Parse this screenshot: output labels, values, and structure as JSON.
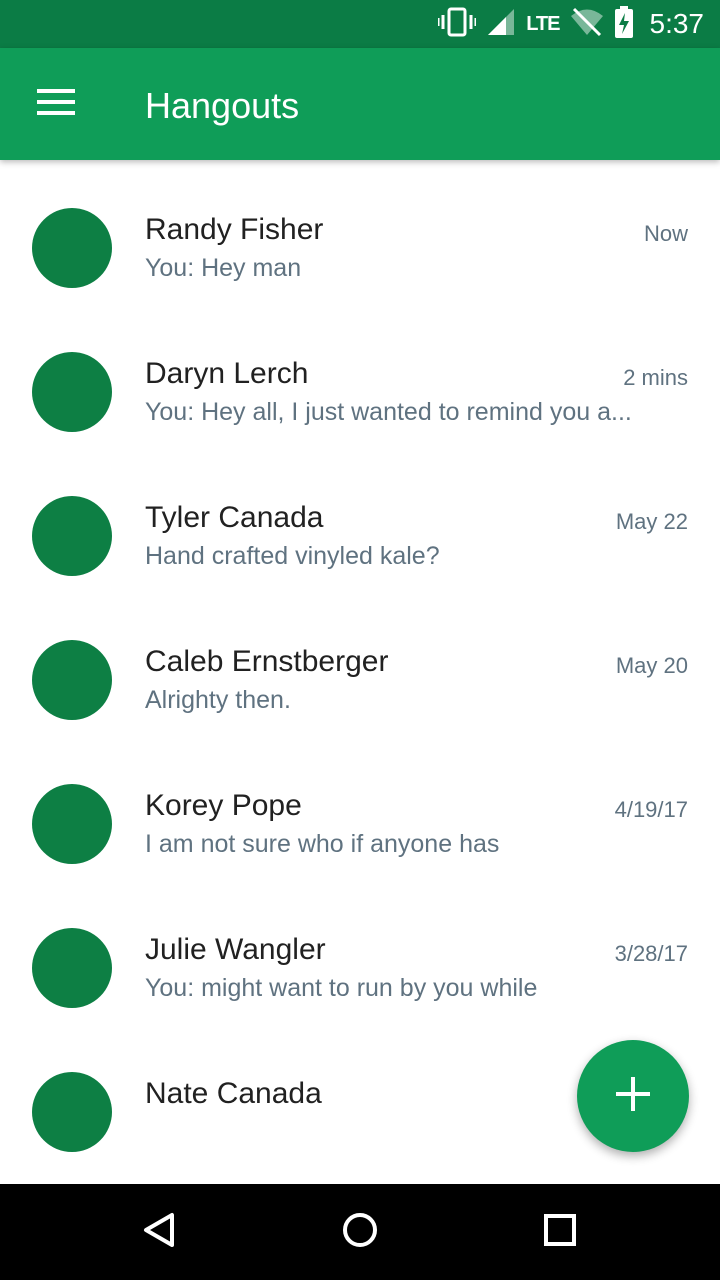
{
  "status_bar": {
    "time": "5:37",
    "network_label": "LTE",
    "icons": [
      "vibrate-icon",
      "cell-signal-icon",
      "wifi-off-icon",
      "battery-charging-icon"
    ],
    "background_color": "#0b7c45"
  },
  "app_bar": {
    "title": "Hangouts",
    "menu_icon": "hamburger-menu-icon",
    "background_color": "#0f9d58"
  },
  "conversations": [
    {
      "name": "Randy Fisher",
      "snippet": "You: Hey man",
      "time": "Now"
    },
    {
      "name": "Daryn Lerch",
      "snippet": "You: Hey all, I just wanted to remind you a...",
      "time": "2 mins"
    },
    {
      "name": "Tyler Canada",
      "snippet": "Hand crafted vinyled kale?",
      "time": "May 22"
    },
    {
      "name": "Caleb Ernstberger",
      "snippet": "Alrighty then.",
      "time": "May 20"
    },
    {
      "name": "Korey Pope",
      "snippet": "I am not sure who if anyone has",
      "time": "4/19/17"
    },
    {
      "name": "Julie Wangler",
      "snippet": "You: might want to run by you while",
      "time": "3/28/17"
    },
    {
      "name": "Nate Canada",
      "snippet": "",
      "time": ""
    }
  ],
  "avatar_color": "#0d7f44",
  "fab": {
    "icon": "plus-icon",
    "color": "#0f9d58"
  },
  "nav_bar": {
    "buttons": [
      "back-icon",
      "home-icon",
      "recents-icon"
    ]
  }
}
